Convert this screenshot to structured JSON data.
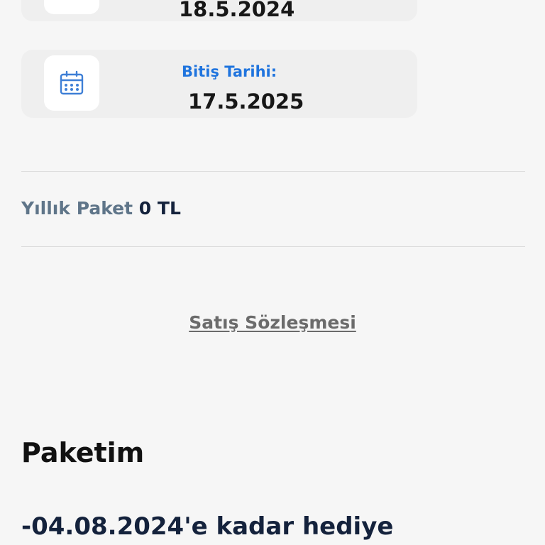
{
  "subscription": {
    "start": {
      "icon": "calendar-icon",
      "date": "18.5.2024"
    },
    "end": {
      "icon": "calendar-icon",
      "label": "Bitiş Tarihi:",
      "date": "17.5.2025"
    }
  },
  "price": {
    "label": "Yıllık Paket",
    "value": "0 TL"
  },
  "contract_link": "Satış Sözleşmesi",
  "package": {
    "title": "Paketim",
    "gift_text": "-04.08.2024'e kadar hediye"
  },
  "colors": {
    "accent": "#1f74de",
    "label_gray": "#5f7589",
    "navy": "#14223c"
  }
}
